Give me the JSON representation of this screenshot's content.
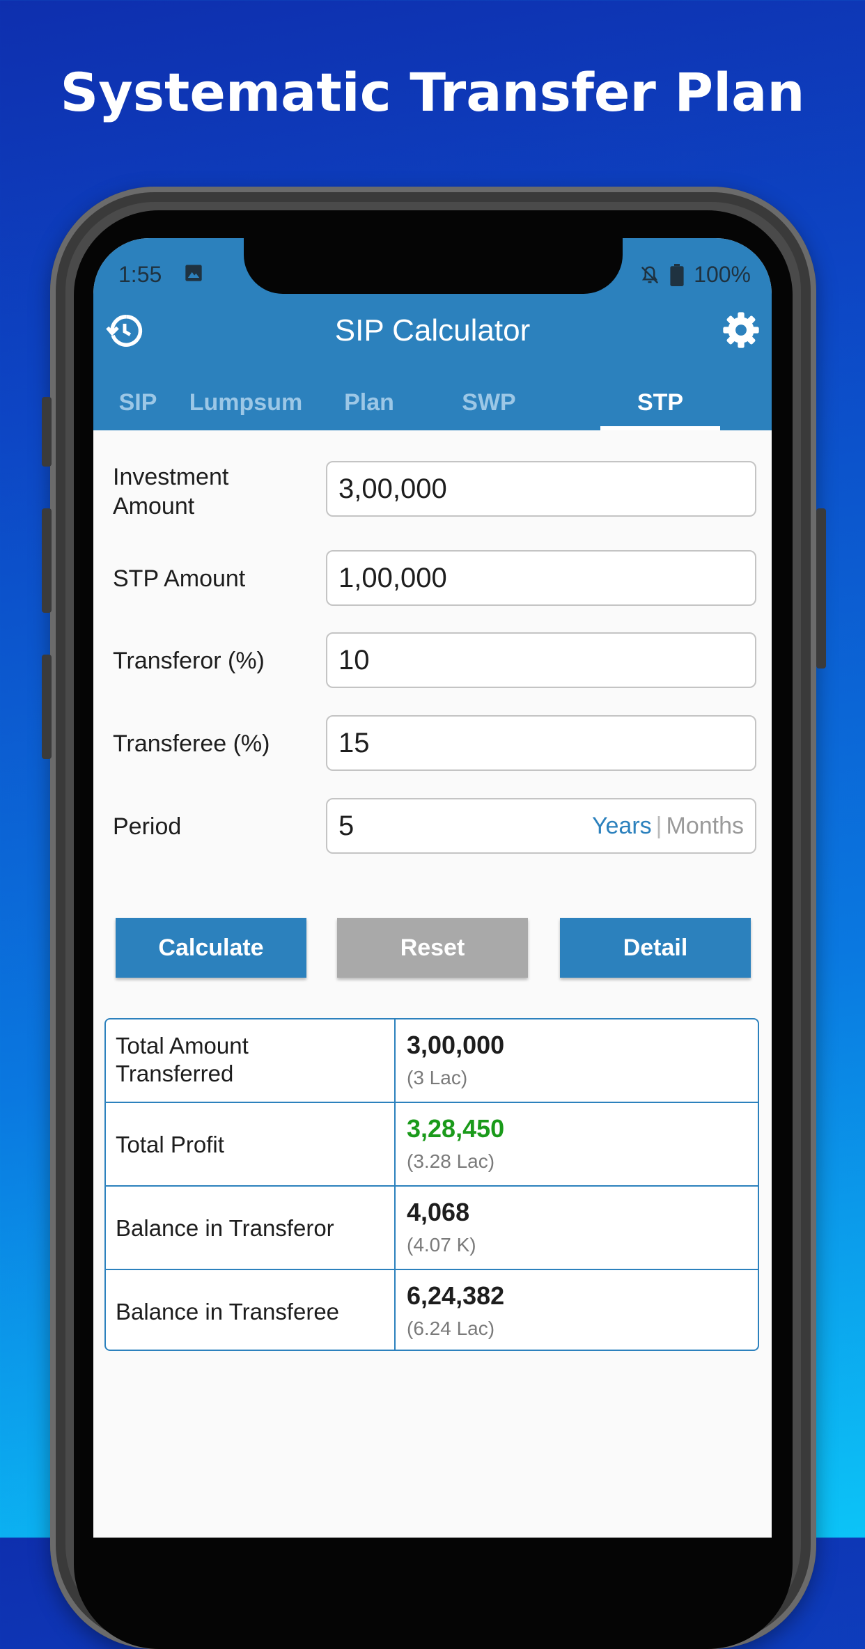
{
  "headline": "Systematic Transfer Plan",
  "status_bar": {
    "time": "1:55",
    "battery": "100%"
  },
  "app_bar": {
    "title": "SIP Calculator"
  },
  "tabs": [
    {
      "label": "SIP",
      "active": false
    },
    {
      "label": "Lumpsum",
      "active": false
    },
    {
      "label": "Plan",
      "active": false
    },
    {
      "label": "SWP",
      "active": false
    },
    {
      "label": "STP",
      "active": true
    }
  ],
  "form": {
    "investment_amount": {
      "label": "Investment Amount",
      "value": "3,00,000"
    },
    "stp_amount": {
      "label": "STP Amount",
      "value": "1,00,000"
    },
    "transferor": {
      "label": "Transferor (%)",
      "value": "10"
    },
    "transferee": {
      "label": "Transferee (%)",
      "value": "15"
    },
    "period": {
      "label": "Period",
      "value": "5",
      "unit_years": "Years",
      "unit_separator": "|",
      "unit_months": "Months",
      "selected_unit": "Years"
    }
  },
  "buttons": {
    "calculate": "Calculate",
    "reset": "Reset",
    "detail": "Detail"
  },
  "results": [
    {
      "label": "Total Amount Transferred",
      "value": "3,00,000",
      "sub": "(3 Lac)"
    },
    {
      "label": "Total Profit",
      "value": "3,28,450",
      "sub": "(3.28 Lac)"
    },
    {
      "label": "Balance in Transferor",
      "value": "4,068",
      "sub": "(4.07 K)"
    },
    {
      "label": "Balance in Transferee",
      "value": "6,24,382",
      "sub": "(6.24 Lac)"
    }
  ],
  "colors": {
    "primary": "#2c81bd",
    "profit": "#1a9a1a",
    "reset_button": "#a9a9a9"
  }
}
